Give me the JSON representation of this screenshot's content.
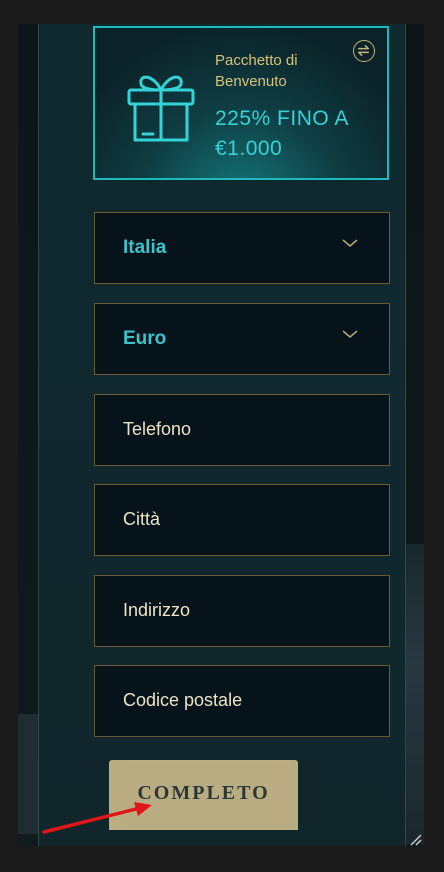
{
  "promo": {
    "title": "Pacchetto di Benvenuto",
    "offer": "225% FINO A €1.000",
    "icons": [
      "gift-icon",
      "swap-icon"
    ]
  },
  "form": {
    "country": "Italia",
    "currency": "Euro",
    "phone_placeholder": "Telefono",
    "city_placeholder": "Città",
    "address_placeholder": "Indirizzo",
    "postal_placeholder": "Codice postale"
  },
  "submit": {
    "label": "COMPLETO"
  },
  "colors": {
    "accent_teal": "#33d3d8",
    "gold": "#d9c27a",
    "field_border": "#6b5b34",
    "button": "#c9b88a",
    "annotation_arrow": "#e0161b"
  }
}
